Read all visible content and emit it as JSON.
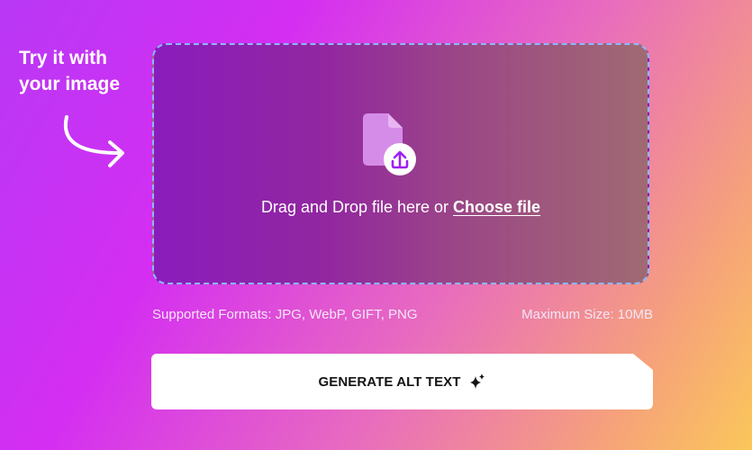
{
  "hint": {
    "line1": "Try it with",
    "line2": "your image"
  },
  "dropzone": {
    "prompt_text": "Drag and Drop file here or ",
    "choose_link": "Choose file",
    "icon": "file-upload-icon"
  },
  "meta": {
    "supported_formats": "Supported Formats: JPG, WebP, GIFT, PNG",
    "max_size": "Maximum Size: 10MB"
  },
  "generate_button": {
    "label": "GENERATE ALT TEXT",
    "icon": "sparkle-icon"
  },
  "colors": {
    "dropzone_border": "#8fb6ff",
    "upload_accent": "#a020f0",
    "button_bg": "#ffffff"
  }
}
